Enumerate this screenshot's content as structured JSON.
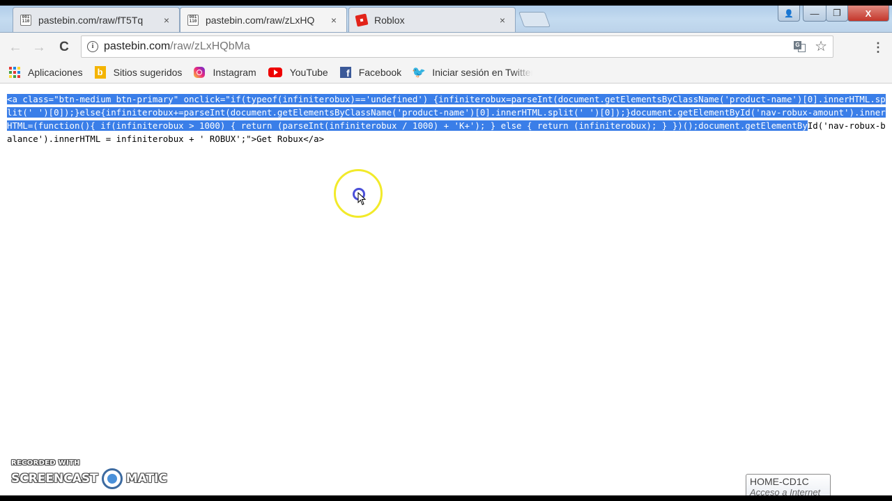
{
  "browser": {
    "tabs": [
      {
        "title": "pastebin.com/raw/fT5Tq",
        "icon": "pastebin-icon",
        "active": false,
        "close": "×"
      },
      {
        "title": "pastebin.com/raw/zLxHQ",
        "icon": "pastebin-icon",
        "active": true,
        "close": "×"
      },
      {
        "title": "Roblox",
        "icon": "roblox-icon",
        "active": false,
        "close": "×"
      }
    ],
    "window_controls": {
      "profile": "👤",
      "minimize": "—",
      "restore": "❐",
      "close": "X"
    },
    "nav": {
      "back": "←",
      "forward": "→",
      "reload": "C"
    },
    "omnibox": {
      "host": "pastebin.com",
      "path": "/raw/zLxHQbMa",
      "info_icon": "i",
      "star": "☆"
    },
    "menu": "⋮",
    "bookmarks": [
      {
        "label": "Aplicaciones",
        "icon": "apps-grid-icon"
      },
      {
        "label": "Sitios sugeridos",
        "icon": "bing-icon"
      },
      {
        "label": "Instagram",
        "icon": "instagram-icon"
      },
      {
        "label": "YouTube",
        "icon": "youtube-icon"
      },
      {
        "label": "Facebook",
        "icon": "facebook-icon"
      },
      {
        "label": "Iniciar sesión en Twitter",
        "icon": "twitter-icon"
      }
    ]
  },
  "page": {
    "code_selected": "<a class=\"btn-medium btn-primary\" onclick=\"if(typeof(infiniterobux)=='undefined') {infiniterobux=parseInt(document.getElementsByClassName('product-name')[0].innerHTML.split(' ')[0]);}else{infiniterobux+=parseInt(document.getElementsByClassName('product-name')[0].innerHTML.split(' ')[0]);}document.getElementById('nav-robux-amount').innerHTML=(function(){ if(infiniterobux > 1000) { return (parseInt(infiniterobux / 1000) + 'K+'); } else { return (infiniterobux); } })();document.getElementBy",
    "code_unselected": "Id('nav-robux-balance').innerHTML = infiniterobux + ' ROBUX';\">Get Robux</a>"
  },
  "overlay": {
    "watermark_top": "RECORDED WITH",
    "watermark_left": "SCREENCAST",
    "watermark_right": "MATIC",
    "tooltip_title": "HOME-CD1C",
    "tooltip_sub": "Acceso a Internet"
  },
  "colors": {
    "selection": "#3a7ee8",
    "cursor_ring": "#f2ea2a",
    "cursor_click": "#4a4fd8"
  }
}
